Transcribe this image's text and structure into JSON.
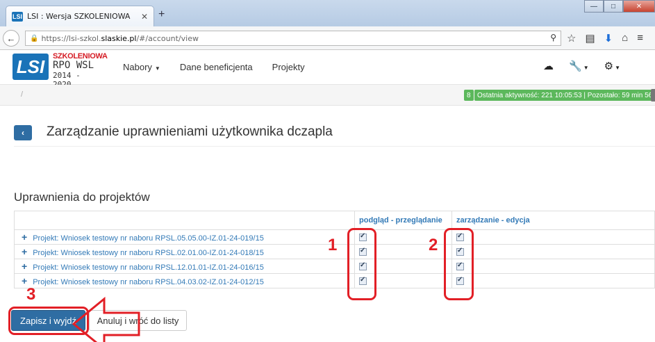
{
  "browser": {
    "tab_title": "LSI : Wersja SZKOLENIOWA",
    "tab_favicon": "LSI",
    "url_prefix": "https://lsi-szkol.",
    "url_host": "slaskie.pl",
    "url_path": "/#/account/view"
  },
  "header": {
    "logo_lsi": "LSI",
    "logo_szkoleniowa": "SZKOLENIOWA",
    "logo_rpo": "RPO WSL",
    "logo_years": "2014 - 2020",
    "menu": [
      {
        "label": "Nabory"
      },
      {
        "label": "Dane beneficjenta"
      },
      {
        "label": "Projekty"
      }
    ]
  },
  "status": {
    "breadcrumb": "/",
    "count": "8",
    "activity": "Ostatnia aktywność: 221 10:05:53 | Pozostało: 59 min 56 s"
  },
  "page": {
    "title": "Zarządzanie uprawnieniami użytkownika dczapla",
    "section_title": "Uprawnienia do projektów"
  },
  "table": {
    "headers": [
      "",
      "podgląd - przeglądanie",
      "zarządzanie - edycja"
    ],
    "rows": [
      {
        "project": "Projekt: Wniosek testowy nr naboru RPSL.05.05.00-IZ.01-24-019/15"
      },
      {
        "project": "Projekt: Wniosek testowy nr naboru RPSL.02.01.00-IZ.01-24-018/15"
      },
      {
        "project": "Projekt: Wniosek testowy nr naboru RPSL.12.01.01-IZ.01-24-016/15"
      },
      {
        "project": "Projekt: Wniosek testowy nr naboru RPSL.04.03.02-IZ.01-24-012/15"
      }
    ]
  },
  "buttons": {
    "save": "Zapisz i wyjdź",
    "cancel": "Anuluj i wróć do listy"
  },
  "annotations": {
    "n1": "1",
    "n2": "2",
    "n3": "3",
    "color": "#e21f26"
  },
  "colors": {
    "primary": "#2f6da3",
    "link": "#337ab7",
    "success": "#5cb85c"
  }
}
